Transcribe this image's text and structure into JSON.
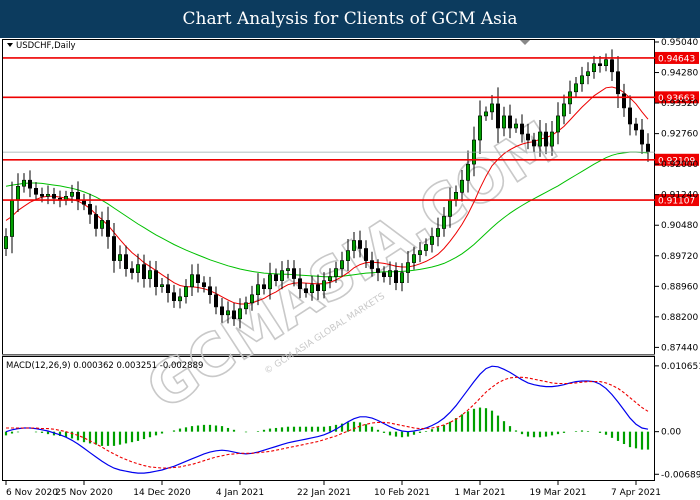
{
  "banner": {
    "title": "Chart Analysis for Clients of GCM Asia"
  },
  "watermark": {
    "text": "GCMASIA.COM",
    "subtext": "© GCM ASIA GLOBAL MARKETS"
  },
  "colors": {
    "bull": "#00a000",
    "bear": "#000000",
    "level": "#ee0000",
    "ma_fast": "#ee0000",
    "ma_slow": "#00c000",
    "macd_line": "#0000ee",
    "macd_signal": "#ee0000",
    "macd_hist": "#00a000",
    "banner": "#0c3b5e"
  },
  "chart_data": [
    {
      "type": "candlestick",
      "symbol_label": "USDCHF,Daily",
      "ylim": [
        0.874,
        0.9504
      ],
      "y_ticks": [
        "0.95040",
        "0.94280",
        "0.93520",
        "0.92760",
        "0.92000",
        "0.91240",
        "0.90480",
        "0.89720",
        "0.88960",
        "0.88200",
        "0.87440"
      ],
      "x_ticks": [
        {
          "label": "6 Nov 2020",
          "index": 0
        },
        {
          "label": "25 Nov 2020",
          "index": 13
        },
        {
          "label": "14 Dec 2020",
          "index": 26
        },
        {
          "label": "4 Jan 2021",
          "index": 39
        },
        {
          "label": "22 Jan 2021",
          "index": 53
        },
        {
          "label": "10 Feb 2021",
          "index": 66
        },
        {
          "label": "1 Mar 2021",
          "index": 79
        },
        {
          "label": "19 Mar 2021",
          "index": 92
        },
        {
          "label": "7 Apr 2021",
          "index": 105
        }
      ],
      "levels": [
        {
          "value": 0.94643,
          "label": "0.94643"
        },
        {
          "value": 0.93663,
          "label": "0.93663"
        },
        {
          "value": 0.92109,
          "label": "0.92109"
        },
        {
          "value": 0.91107,
          "label": "0.91107"
        }
      ],
      "current_price": 0.923,
      "closes": [
        0.902,
        0.911,
        0.9145,
        0.916,
        0.914,
        0.9125,
        0.912,
        0.9125,
        0.9115,
        0.911,
        0.912,
        0.913,
        0.911,
        0.91,
        0.9075,
        0.904,
        0.906,
        0.902,
        0.896,
        0.8975,
        0.894,
        0.893,
        0.895,
        0.8915,
        0.8935,
        0.8895,
        0.89,
        0.888,
        0.886,
        0.887,
        0.8895,
        0.8925,
        0.8905,
        0.8895,
        0.8875,
        0.8845,
        0.8825,
        0.8835,
        0.8815,
        0.884,
        0.8855,
        0.8875,
        0.89,
        0.889,
        0.8925,
        0.891,
        0.8935,
        0.894,
        0.8915,
        0.889,
        0.888,
        0.89,
        0.8885,
        0.891,
        0.892,
        0.894,
        0.896,
        0.8985,
        0.901,
        0.899,
        0.896,
        0.894,
        0.893,
        0.892,
        0.8935,
        0.8905,
        0.893,
        0.8955,
        0.8975,
        0.8985,
        0.9,
        0.902,
        0.904,
        0.907,
        0.911,
        0.913,
        0.916,
        0.92,
        0.926,
        0.932,
        0.933,
        0.935,
        0.929,
        0.932,
        0.929,
        0.93,
        0.9275,
        0.926,
        0.9245,
        0.928,
        0.9245,
        0.928,
        0.932,
        0.935,
        0.938,
        0.94,
        0.942,
        0.943,
        0.945,
        0.9445,
        0.946,
        0.943,
        0.9375,
        0.934,
        0.93,
        0.9285,
        0.925,
        0.923
      ],
      "ma_fast": [
        0.906,
        0.907,
        0.9085,
        0.9095,
        0.9105,
        0.9112,
        0.9118,
        0.912,
        0.912,
        0.9118,
        0.9115,
        0.9112,
        0.9108,
        0.91,
        0.909,
        0.9075,
        0.9062,
        0.9048,
        0.903,
        0.9012,
        0.8995,
        0.898,
        0.8968,
        0.8955,
        0.8945,
        0.8935,
        0.8925,
        0.8915,
        0.8905,
        0.8898,
        0.8895,
        0.8895,
        0.8893,
        0.889,
        0.8885,
        0.8878,
        0.887,
        0.8862,
        0.8855,
        0.8852,
        0.8852,
        0.8855,
        0.886,
        0.8866,
        0.8875,
        0.8882,
        0.8892,
        0.89,
        0.8904,
        0.8905,
        0.8904,
        0.8903,
        0.8902,
        0.8903,
        0.8906,
        0.8912,
        0.892,
        0.893,
        0.8942,
        0.895,
        0.8955,
        0.8956,
        0.8955,
        0.8953,
        0.895,
        0.8946,
        0.8944,
        0.8944,
        0.8947,
        0.8952,
        0.8958,
        0.8966,
        0.8976,
        0.899,
        0.9008,
        0.9028,
        0.905,
        0.9076,
        0.9106,
        0.914,
        0.917,
        0.9196,
        0.9212,
        0.9226,
        0.9236,
        0.9244,
        0.925,
        0.9254,
        0.9256,
        0.9262,
        0.9266,
        0.9272,
        0.9282,
        0.9294,
        0.931,
        0.9326,
        0.9342,
        0.9356,
        0.937,
        0.938,
        0.939,
        0.9392,
        0.9388,
        0.9378,
        0.9365,
        0.935,
        0.933,
        0.9312
      ],
      "ma_slow": [
        0.9145,
        0.9148,
        0.915,
        0.9152,
        0.9153,
        0.9153,
        0.9152,
        0.915,
        0.9148,
        0.9146,
        0.9143,
        0.914,
        0.9136,
        0.9131,
        0.9125,
        0.9118,
        0.911,
        0.9101,
        0.9091,
        0.9081,
        0.9071,
        0.9061,
        0.9051,
        0.9042,
        0.9033,
        0.9024,
        0.9016,
        0.9008,
        0.9,
        0.8993,
        0.8986,
        0.898,
        0.8974,
        0.8968,
        0.8962,
        0.8957,
        0.8952,
        0.8947,
        0.8943,
        0.8939,
        0.8936,
        0.8933,
        0.8931,
        0.8929,
        0.8928,
        0.8927,
        0.8926,
        0.8926,
        0.8925,
        0.8924,
        0.8923,
        0.8922,
        0.8921,
        0.892,
        0.892,
        0.892,
        0.8921,
        0.8923,
        0.8925,
        0.8927,
        0.8929,
        0.893,
        0.8931,
        0.8932,
        0.8932,
        0.8932,
        0.8933,
        0.8934,
        0.8936,
        0.8938,
        0.8941,
        0.8944,
        0.8948,
        0.8953,
        0.896,
        0.8968,
        0.8977,
        0.8988,
        0.9,
        0.9014,
        0.9028,
        0.9042,
        0.9055,
        0.9067,
        0.9078,
        0.9088,
        0.9097,
        0.9106,
        0.9114,
        0.9122,
        0.913,
        0.9138,
        0.9146,
        0.9155,
        0.9164,
        0.9173,
        0.9182,
        0.9191,
        0.92,
        0.9208,
        0.9216,
        0.9222,
        0.9226,
        0.9228,
        0.923,
        0.923,
        0.9229,
        0.9228
      ]
    },
    {
      "type": "line",
      "indicator_label": "MACD(12,26,9) 0.000362 0.003251 -0.002889",
      "ylim": [
        -0.0075,
        0.0116
      ],
      "y_ticks": [
        {
          "label": "0.010651",
          "value": 0.010651
        },
        {
          "label": "0.00",
          "value": 0.0
        },
        {
          "label": "-0.006897",
          "value": -0.006897
        }
      ],
      "series": [
        {
          "key": "macd",
          "values": [
            0.0,
            0.0003,
            0.0005,
            0.0006,
            0.0006,
            0.0005,
            0.0003,
            0.0001,
            -0.0002,
            -0.0005,
            -0.0009,
            -0.0014,
            -0.002,
            -0.0027,
            -0.0034,
            -0.0041,
            -0.0048,
            -0.0054,
            -0.0059,
            -0.0062,
            -0.0064,
            -0.0066,
            -0.0067,
            -0.0067,
            -0.0066,
            -0.0064,
            -0.0062,
            -0.0059,
            -0.0056,
            -0.0052,
            -0.0048,
            -0.0044,
            -0.004,
            -0.0036,
            -0.0033,
            -0.0031,
            -0.003,
            -0.0031,
            -0.0033,
            -0.0035,
            -0.0036,
            -0.0035,
            -0.0033,
            -0.003,
            -0.0027,
            -0.0024,
            -0.0021,
            -0.0018,
            -0.0016,
            -0.0014,
            -0.0012,
            -0.001,
            -0.0008,
            -0.0005,
            -0.0001,
            0.0004,
            0.001,
            0.0016,
            0.0021,
            0.0024,
            0.0024,
            0.0022,
            0.0018,
            0.0013,
            0.0008,
            0.0004,
            0.0001,
            0.0,
            0.0001,
            0.0003,
            0.0006,
            0.001,
            0.0015,
            0.0022,
            0.0031,
            0.0042,
            0.0055,
            0.0068,
            0.0081,
            0.0093,
            0.0102,
            0.0106,
            0.0105,
            0.0101,
            0.0096,
            0.009,
            0.0084,
            0.0079,
            0.0076,
            0.0074,
            0.0073,
            0.0073,
            0.0074,
            0.0076,
            0.0079,
            0.0081,
            0.0082,
            0.0082,
            0.0081,
            0.0077,
            0.007,
            0.006,
            0.0048,
            0.0035,
            0.0022,
            0.0012,
            0.0006,
            0.0004
          ]
        },
        {
          "key": "signal",
          "values": [
            0.0006,
            0.0006,
            0.0006,
            0.0006,
            0.0006,
            0.0006,
            0.0005,
            0.0005,
            0.0004,
            0.0002,
            0.0,
            -0.0003,
            -0.0006,
            -0.001,
            -0.0015,
            -0.002,
            -0.0025,
            -0.0031,
            -0.0036,
            -0.0041,
            -0.0045,
            -0.0049,
            -0.0052,
            -0.0055,
            -0.0057,
            -0.0058,
            -0.0059,
            -0.0059,
            -0.0058,
            -0.0057,
            -0.0055,
            -0.0053,
            -0.005,
            -0.0047,
            -0.0044,
            -0.0041,
            -0.0039,
            -0.0037,
            -0.0036,
            -0.0035,
            -0.0035,
            -0.0035,
            -0.0034,
            -0.0033,
            -0.0032,
            -0.003,
            -0.0028,
            -0.0026,
            -0.0024,
            -0.0022,
            -0.002,
            -0.0018,
            -0.0016,
            -0.0013,
            -0.001,
            -0.0007,
            -0.0003,
            0.0001,
            0.0005,
            0.0009,
            0.0012,
            0.0014,
            0.0015,
            0.0015,
            0.0014,
            0.0012,
            0.001,
            0.0008,
            0.0006,
            0.0005,
            0.0005,
            0.0006,
            0.0008,
            0.0011,
            0.0015,
            0.002,
            0.0027,
            0.0035,
            0.0044,
            0.0054,
            0.0064,
            0.0072,
            0.0079,
            0.0084,
            0.0087,
            0.0088,
            0.0088,
            0.0087,
            0.0085,
            0.0083,
            0.0081,
            0.0079,
            0.0078,
            0.0078,
            0.0078,
            0.0079,
            0.008,
            0.0081,
            0.0081,
            0.0081,
            0.0079,
            0.0075,
            0.007,
            0.0063,
            0.0055,
            0.0047,
            0.0039,
            0.0033
          ]
        }
      ],
      "histogram": {
        "key": "histogram",
        "values": [
          -0.0006,
          -0.0003,
          -0.0001,
          0.0,
          0.0,
          -0.0001,
          -0.0002,
          -0.0004,
          -0.0006,
          -0.0007,
          -0.0009,
          -0.0011,
          -0.0014,
          -0.0017,
          -0.0019,
          -0.0021,
          -0.0023,
          -0.0023,
          -0.0023,
          -0.0021,
          -0.0019,
          -0.0017,
          -0.0015,
          -0.0012,
          -0.0009,
          -0.0006,
          -0.0003,
          0.0,
          0.0002,
          0.0005,
          0.0007,
          0.0009,
          0.001,
          0.0011,
          0.0011,
          0.001,
          0.0009,
          0.0006,
          0.0003,
          0.0,
          -0.0001,
          0.0,
          0.0001,
          0.0003,
          0.0005,
          0.0006,
          0.0007,
          0.0008,
          0.0008,
          0.0008,
          0.0008,
          0.0008,
          0.0008,
          0.0008,
          0.0009,
          0.0011,
          0.0013,
          0.0015,
          0.0016,
          0.0015,
          0.0012,
          0.0008,
          0.0003,
          -0.0002,
          -0.0006,
          -0.0008,
          -0.0009,
          -0.0008,
          -0.0005,
          -0.0002,
          0.0001,
          0.0004,
          0.0007,
          0.0011,
          0.0016,
          0.0022,
          0.0028,
          0.0033,
          0.0037,
          0.0039,
          0.0038,
          0.0034,
          0.0026,
          0.0017,
          0.0009,
          0.0002,
          -0.0004,
          -0.0008,
          -0.0009,
          -0.0009,
          -0.0008,
          -0.0006,
          -0.0004,
          -0.0002,
          0.0,
          0.0001,
          0.0002,
          0.0001,
          0.0,
          -0.0002,
          -0.0005,
          -0.001,
          -0.0015,
          -0.002,
          -0.0025,
          -0.0027,
          -0.0029,
          -0.0029
        ]
      }
    }
  ]
}
